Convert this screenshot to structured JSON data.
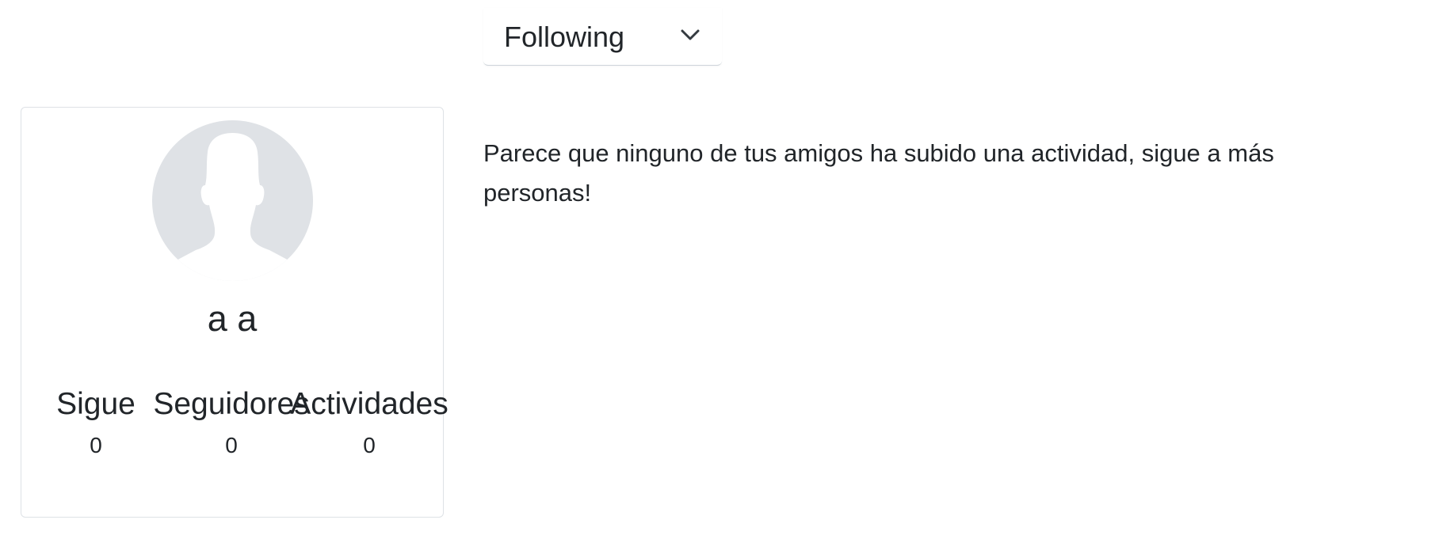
{
  "feed_filter": {
    "selected": "Following",
    "icon": "chevron-down-icon"
  },
  "profile": {
    "avatar_icon": "user-silhouette-icon",
    "name": "a a",
    "stats": {
      "following": {
        "label": "Sigue",
        "value": "0"
      },
      "followers": {
        "label": "Seguidores",
        "value": "0"
      },
      "activities": {
        "label": "Actividades",
        "value": "0"
      }
    }
  },
  "feed": {
    "empty_message": "Parece que ninguno de tus amigos ha subido una actividad, sigue a más personas!"
  },
  "colors": {
    "text": "#212529",
    "border": "#dee2e6",
    "avatar_background": "#dfe2e6",
    "avatar_silhouette": "#ffffff"
  }
}
